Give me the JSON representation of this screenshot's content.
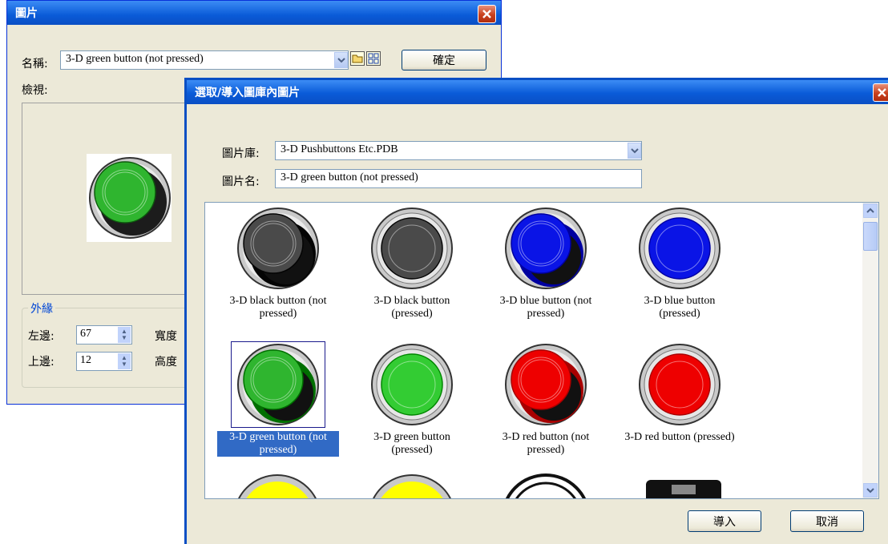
{
  "bg_dialog": {
    "title": "圖片",
    "name_label": "名稱:",
    "name_value": "3-D green button (not pressed)",
    "ok_label": "確定",
    "preview_label": "檢視:",
    "border_group_label": "外緣",
    "left_label": "左邊:",
    "left_value": "67",
    "top_label": "上邊:",
    "top_value": "12",
    "width_label": "寬度",
    "height_label": "高度"
  },
  "fg_dialog": {
    "title": "選取/導入圖庫內圖片",
    "library_label": "圖片庫:",
    "library_value": "3-D Pushbuttons Etc.PDB",
    "picname_label": "圖片名:",
    "picname_value": "3-D green button (not pressed)",
    "import_label": "導入",
    "cancel_label": "取消",
    "items": [
      {
        "line1": "3-D black button (not",
        "line2": "pressed)",
        "color": "#4a4a4a",
        "pressed": false
      },
      {
        "line1": "3-D black button",
        "line2": "(pressed)",
        "color": "#4a4a4a",
        "pressed": true
      },
      {
        "line1": "3-D blue button (not",
        "line2": "pressed)",
        "color": "#0a14e6",
        "pressed": false
      },
      {
        "line1": "3-D blue button",
        "line2": "(pressed)",
        "color": "#0a14e6",
        "pressed": true
      },
      {
        "line1": "3-D green button (not",
        "line2": "pressed)",
        "color": "#2fb52f",
        "pressed": false,
        "selected": true
      },
      {
        "line1": "3-D green button",
        "line2": "(pressed)",
        "color": "#33cc33",
        "pressed": true
      },
      {
        "line1": "3-D red button (not",
        "line2": "pressed)",
        "color": "#ee0000",
        "pressed": false
      },
      {
        "line1": "3-D red button (pressed)",
        "line2": "",
        "color": "#ee0000",
        "pressed": true
      }
    ]
  },
  "colors": {
    "titlebar_start": "#0a5bd8",
    "titlebar_end": "#3c8cf5",
    "selection": "#316ac5"
  }
}
